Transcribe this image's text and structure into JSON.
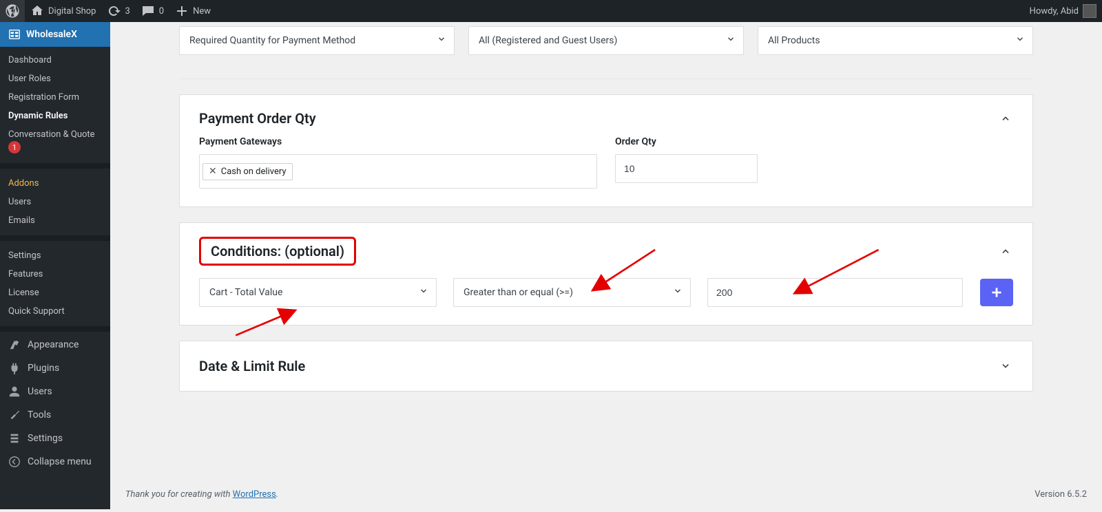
{
  "adminbar": {
    "site_name": "Digital Shop",
    "updates": "3",
    "comments": "0",
    "new_label": "New",
    "howdy": "Howdy, Abid"
  },
  "sidebar": {
    "top_label": "WholesaleX",
    "items": [
      {
        "label": "Dashboard"
      },
      {
        "label": "User Roles"
      },
      {
        "label": "Registration Form"
      },
      {
        "label": "Dynamic Rules",
        "current": true
      },
      {
        "label": "Conversation & Quote",
        "badge": "1"
      },
      {
        "label": "Addons",
        "highlight": true
      },
      {
        "label": "Users"
      },
      {
        "label": "Emails"
      },
      {
        "label": "Settings"
      },
      {
        "label": "Features"
      },
      {
        "label": "License"
      },
      {
        "label": "Quick Support"
      }
    ],
    "bottom": {
      "appearance": "Appearance",
      "plugins": "Plugins",
      "users": "Users",
      "tools": "Tools",
      "settings": "Settings",
      "collapse": "Collapse menu"
    }
  },
  "top_selects": {
    "rule": "Required Quantity for Payment Method",
    "users": "All (Registered and Guest Users)",
    "products": "All Products"
  },
  "payment_panel": {
    "title": "Payment Order Qty",
    "gateways_label": "Payment Gateways",
    "gateway_chip": "Cash on delivery",
    "qty_label": "Order Qty",
    "qty_value": "10"
  },
  "conditions_panel": {
    "title": "Conditions: (optional)",
    "field": "Cart - Total Value",
    "operator": "Greater than or equal (>=)",
    "value": "200"
  },
  "date_panel": {
    "title": "Date & Limit Rule"
  },
  "footer": {
    "thanks_pre": "Thank you for creating with ",
    "wp": "WordPress",
    "thanks_post": ".",
    "version": "Version 6.5.2"
  }
}
